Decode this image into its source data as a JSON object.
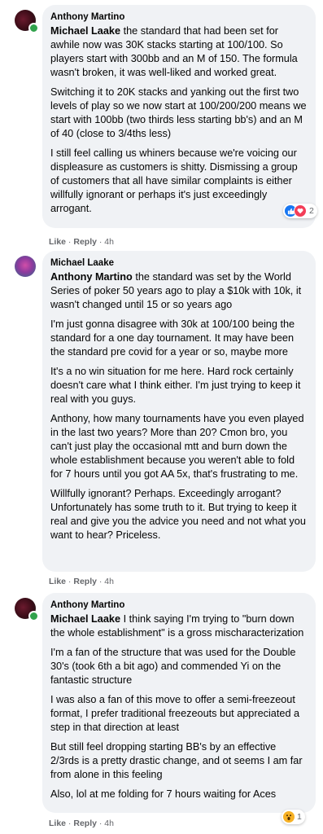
{
  "comments": [
    {
      "author": "Anthony Martino",
      "mention": "Michael Laake",
      "paragraphs": [
        " the standard that had been set for awhile now was 30K stacks starting at 100/100. So players start with 300bb and an M of 150. The formula wasn't broken, it was well-liked and worked great.",
        "Switching it to 20K stacks and yanking out the first two levels of play so we now start at 100/200/200 means we start with 100bb (two thirds less starting bb's) and an M of 40 (close to 3/4ths less)",
        "I still feel calling us whiners because we're voicing our displeasure as customers is shitty. Dismissing a group of customers that all have similar complaints is either willfully ignorant or perhaps it's just exceedingly arrogant."
      ],
      "actions": {
        "like": "Like",
        "reply": "Reply",
        "time": "4h"
      },
      "reactions": {
        "icons": [
          "like-icon",
          "heart-icon"
        ],
        "count": "2"
      }
    },
    {
      "author": "Michael Laake",
      "mention": "Anthony Martino",
      "paragraphs": [
        " the standard was set by the World Series of poker 50 years ago to play a $10k with 10k, it wasn't changed until 15 or so years ago",
        "I'm just gonna disagree with 30k at 100/100 being the standard for a one day tournament. It may have been the standard pre covid for a year or so, maybe more",
        "It's a no win situation for me here. Hard rock certainly doesn't care what I think either. I'm just trying to keep it real with you guys.",
        "Anthony, how many tournaments have you even played in the last two years? More than 20? Cmon bro, you can't just play the occasional mtt and burn down the whole establishment because you weren't able to fold for 7 hours until you got AA 5x, that's frustrating to me.",
        "Willfully ignorant? Perhaps. Exceedingly arrogant? Unfortunately has some truth to it. But trying to keep it real and give you the advice you need and not what you want to hear? Priceless."
      ],
      "actions": {
        "like": "Like",
        "reply": "Reply",
        "time": "4h"
      }
    },
    {
      "author": "Anthony Martino",
      "mention": "Michael Laake",
      "paragraphs": [
        " I think saying I'm trying to \"burn down the whole establishment\" is a gross mischaracterization",
        "I'm a fan of the structure that was used for the Double 30's (took 6th a bit ago) and commended Yi on the fantastic structure",
        "I was also a fan of this move to offer a semi-freezeout format, I prefer traditional freezeouts but appreciated a step in that direction at least",
        "But still feel dropping starting BB's by an effective 2/3rds is a pretty drastic change, and ot seems I am far from alone in this feeling",
        "Also, lol at me folding for 7 hours waiting for Aces"
      ],
      "actions": {
        "like": "Like",
        "reply": "Reply",
        "time": "4h"
      },
      "reactions": {
        "icons": [
          "wow-icon"
        ],
        "count": "1"
      }
    }
  ]
}
